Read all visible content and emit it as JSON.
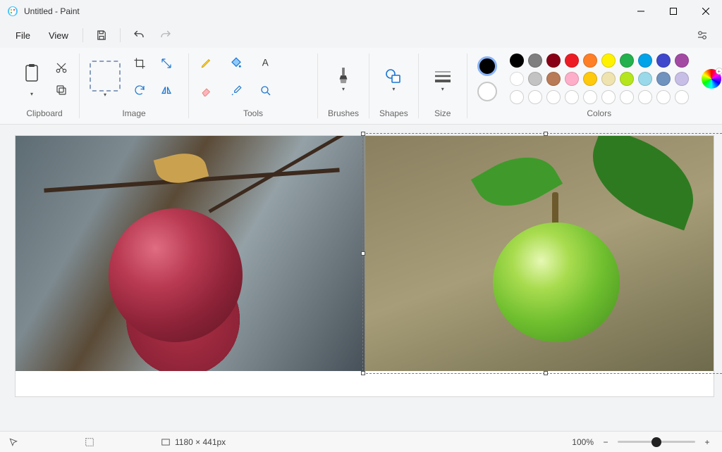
{
  "title": "Untitled - Paint",
  "menu": {
    "file": "File",
    "view": "View"
  },
  "ribbon": {
    "clipboard": "Clipboard",
    "image": "Image",
    "tools": "Tools",
    "brushes": "Brushes",
    "shapes": "Shapes",
    "size": "Size",
    "colors": "Colors"
  },
  "palette_row1": [
    "#000000",
    "#7f7f7f",
    "#880015",
    "#ed1c24",
    "#ff7f27",
    "#fff200",
    "#22b14c",
    "#00a2e8",
    "#3f48cc",
    "#a349a4"
  ],
  "palette_row2": [
    "#ffffff",
    "#c3c3c3",
    "#b97a57",
    "#ffaec9",
    "#ffc90e",
    "#efe4b0",
    "#b5e61d",
    "#99d9ea",
    "#7092be",
    "#c8bfe7"
  ],
  "current_color1": "#000000",
  "current_color2": "#ffffff",
  "status": {
    "cursor": "",
    "selection": "",
    "dimensions": "1180 × 441px",
    "zoom": "100%"
  }
}
